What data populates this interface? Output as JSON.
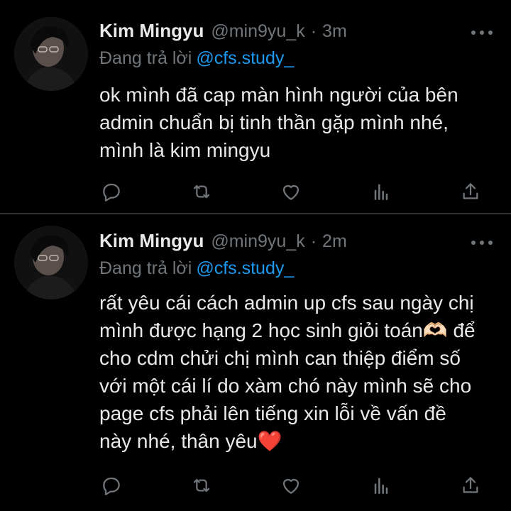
{
  "tweets": [
    {
      "author_name": "Kim Mingyu",
      "handle": "@min9yu_k",
      "separator": "·",
      "time": "3m",
      "replying_prefix": "Đang trả lời",
      "replying_to": "@cfs.study_",
      "body_lines": [
        "ok mình đã cap màn hình người của bên",
        "admin chuẩn bị tinh thần gặp mình nhé,",
        "mình là kim mingyu"
      ]
    },
    {
      "author_name": "Kim Mingyu",
      "handle": "@min9yu_k",
      "separator": "·",
      "time": "2m",
      "replying_prefix": "Đang trả lời",
      "replying_to": "@cfs.study_",
      "body_lines": [
        "rất yêu cái cách admin up cfs sau ngày chị",
        "mình được hạng 2 học sinh giỏi toán🫶🏻 để",
        "cho cdm chửi chị mình can thiệp điểm số",
        "với một cái lí do xàm chó này mình sẽ cho",
        "page cfs phải lên tiếng xin lỗi về vấn đề",
        "này nhé, thân yêu❤️"
      ]
    }
  ],
  "actions": [
    "reply-icon",
    "retweet-icon",
    "like-icon",
    "analytics-icon",
    "share-icon"
  ],
  "colors": {
    "background": "#000000",
    "text": "#e7e9ea",
    "muted": "#71767b",
    "link": "#1d9bf0",
    "divider": "#2f3336"
  }
}
